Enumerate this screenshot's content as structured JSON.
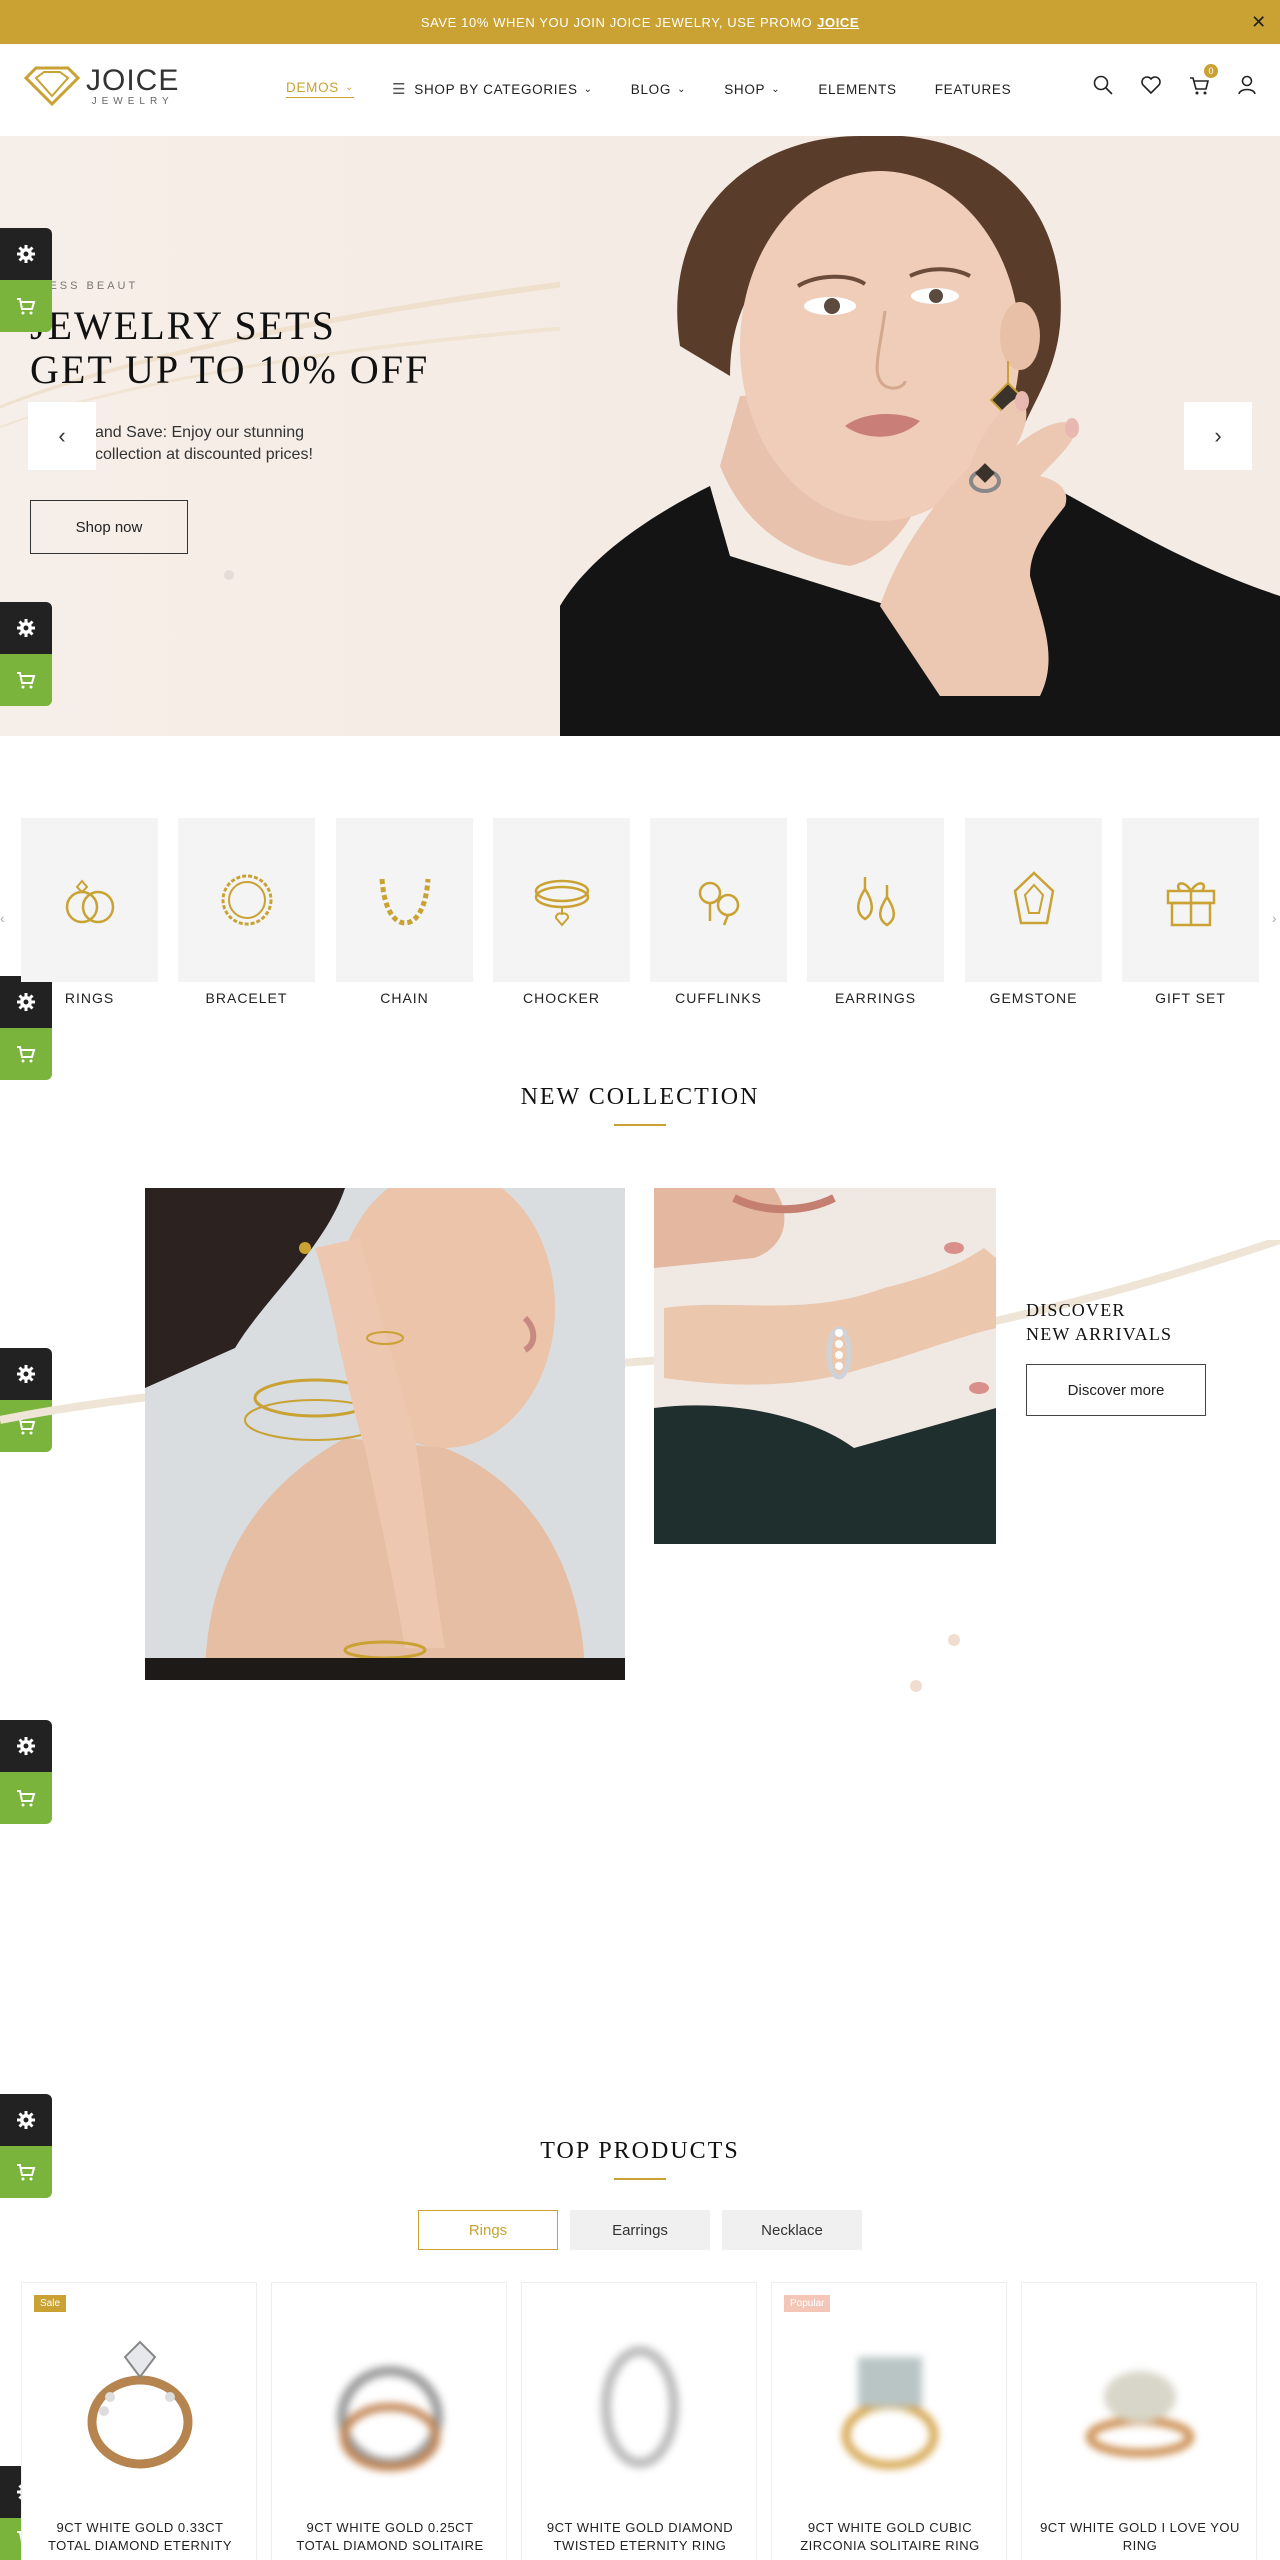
{
  "promo": {
    "text": "SAVE 10% WHEN YOU JOIN JOICE JEWELRY, USE PROMO",
    "code": "JOICE"
  },
  "header": {
    "logo_main": "JOICE",
    "logo_sub": "JEWELRY",
    "nav": [
      {
        "label": "DEMOS"
      },
      {
        "label": "SHOP BY CATEGORIES"
      },
      {
        "label": "BLOG"
      },
      {
        "label": "SHOP"
      },
      {
        "label": "ELEMENTS"
      },
      {
        "label": "FEATURES"
      }
    ],
    "cart_count": "0"
  },
  "hero": {
    "subtitle": "ELESS BEAUT",
    "title_line1": "JEWELRY SETS",
    "title_line2": "GET UP TO 10% OFF",
    "desc_line1": "and Save: Enjoy our stunning",
    "desc_line2": "collection at discounted prices!",
    "cta": "Shop now"
  },
  "categories": [
    {
      "label": "RINGS",
      "icon": "rings-icon"
    },
    {
      "label": "BRACELET",
      "icon": "bracelet-icon"
    },
    {
      "label": "CHAIN",
      "icon": "chain-icon"
    },
    {
      "label": "CHOCKER",
      "icon": "choker-icon"
    },
    {
      "label": "CUFFLINKS",
      "icon": "cufflinks-icon"
    },
    {
      "label": "EARRINGS",
      "icon": "earrings-icon"
    },
    {
      "label": "GEMSTONE",
      "icon": "gemstone-icon"
    },
    {
      "label": "GIFT SET",
      "icon": "gift-icon"
    }
  ],
  "new_collection": {
    "title": "NEW COLLECTION",
    "discover_line1": "DISCOVER",
    "discover_line2": "NEW ARRIVALS",
    "button": "Discover more"
  },
  "top_products": {
    "title": "TOP PRODUCTS",
    "tabs": [
      {
        "label": "Rings"
      },
      {
        "label": "Earrings"
      },
      {
        "label": "Necklace"
      }
    ],
    "products": [
      {
        "name_line1": "9CT WHITE GOLD 0.33CT",
        "name_line2": "TOTAL DIAMOND ETERNITY",
        "tag": "Sale"
      },
      {
        "name_line1": "9CT WHITE GOLD 0.25CT",
        "name_line2": "TOTAL DIAMOND SOLITAIRE",
        "tag": ""
      },
      {
        "name_line1": "9CT WHITE GOLD DIAMOND",
        "name_line2": "TWISTED ETERNITY RING",
        "tag": ""
      },
      {
        "name_line1": "9CT WHITE GOLD CUBIC",
        "name_line2": "ZIRCONIA SOLITAIRE RING",
        "tag": "Popular"
      },
      {
        "name_line1": "9CT WHITE GOLD I LOVE YOU",
        "name_line2": "RING",
        "tag": ""
      }
    ]
  },
  "colors": {
    "accent": "#c9a233",
    "dark": "#222222",
    "green": "#7bb43c",
    "sale": "#c9a233",
    "popular": "#f3c6b8"
  }
}
